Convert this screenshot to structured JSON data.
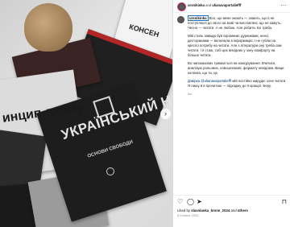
{
  "post": {
    "author": "ursnikinka",
    "and": "and",
    "coauthor": "ulianavaportaliefff"
  },
  "photo": {
    "book_main_title": "УКРАЇНСЬКИЙ НАЦІОНАЛІЗМ",
    "book_main_subtitle": "ОСНОВИ СВОБОДИ",
    "book_left_title": "инцип дизму",
    "book_white_title": "КОНСЕН",
    "toy": "plush toy",
    "next_icon": "chevron-right-icon"
  },
  "caption": {
    "username": "ursnikinka",
    "p1": "Все, що мене знають — знають, що я не поступлюся до свого на мові чи висловлені, що не кажуть. Чесно — читати. А не любою. Але робити. Бо треба.",
    "p2": "Мій стиль завжди був скромним: дурниками, ненсі, десторанами — включала в інформацію. І не гублю на кресло потребу на читати. Але з літератури ону треба сам читати. І я стаю, собі цих вихідних у зону комфорту на більше читати.",
    "p3": "Во напоказових тримається на конкурування. Вчитися, аналізую рольових, новошлемові, формату невідома. Вище колонка, що ти, це.",
    "p4_user": "Дзвірка @ulianavaportaliefff",
    "p4_rest": "мій постійно жируди: хоче читати. Я пишу в я прочитаю — підходжу до її кращої. Беру.",
    "time": "6w"
  },
  "actions": {
    "like_icon": "heart-icon",
    "comment_icon": "comment-icon",
    "share_icon": "send-icon",
    "save_icon": "bookmark-icon",
    "liked_prefix": "Liked by",
    "liked_user": "slavolanka_krone_2024",
    "liked_and": "and",
    "liked_others": "others",
    "date": "8 October 2023"
  }
}
